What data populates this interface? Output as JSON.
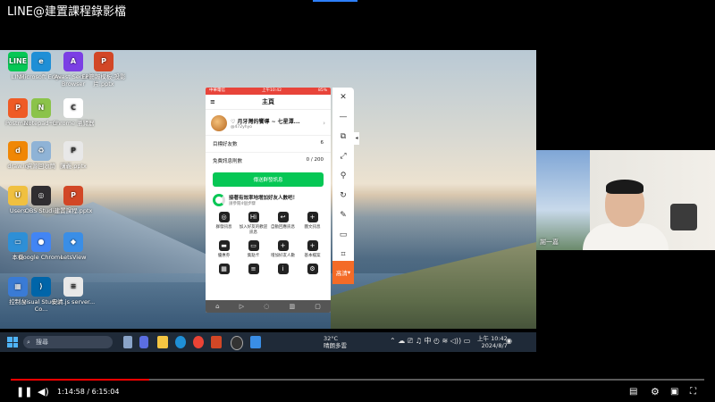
{
  "video_title": "LINE@建置課程錄影檔",
  "desktop_icons": [
    {
      "label": "LINE",
      "glyph": "LINE",
      "color": "#06c755"
    },
    {
      "label": "Microsoft Edge",
      "glyph": "e",
      "color": "#1f8fd6"
    },
    {
      "label": "Avast Secure Browser",
      "glyph": "A",
      "color": "#7b3fe4"
    },
    {
      "label": "EP簡報模板-投影片.pptx",
      "glyph": "P",
      "color": "#d24726"
    },
    {
      "label": "Postman",
      "glyph": "P",
      "color": "#ef5b25"
    },
    {
      "label": "Notepad++",
      "glyph": "N",
      "color": "#8bc34a"
    },
    {
      "label": "Chrome 瀏覽器",
      "glyph": "C",
      "color": "#ffffff"
    },
    {
      "label": "draw.io",
      "glyph": "d",
      "color": "#f08705"
    },
    {
      "label": "資源回收筒",
      "glyph": "♻",
      "color": "#8fb3d6"
    },
    {
      "label": "講義.pptx",
      "glyph": "P",
      "color": "#e8e8e8"
    },
    {
      "label": "Users",
      "glyph": "U",
      "color": "#f0c040"
    },
    {
      "label": "OBS Studio",
      "glyph": "◎",
      "color": "#302e31"
    },
    {
      "label": "建置課程.pptx",
      "glyph": "P",
      "color": "#d24726"
    },
    {
      "label": "本機",
      "glyph": "▭",
      "color": "#2e8fd6"
    },
    {
      "label": "Google Chrome",
      "glyph": "●",
      "color": "#4285f4"
    },
    {
      "label": "LetsView",
      "glyph": "◆",
      "color": "#3a8ee6"
    },
    {
      "label": "控制台",
      "glyph": "▦",
      "color": "#3a7bd5"
    },
    {
      "label": "Visual Studio Co...",
      "glyph": "⟩",
      "color": "#0065a9"
    },
    {
      "label": "安清.js server...",
      "glyph": "≡",
      "color": "#e8e8e8"
    }
  ],
  "taskbar": {
    "search_placeholder": "搜尋",
    "weather_temp": "32°C",
    "weather_text": "晴朗多雲",
    "ime": "中",
    "time": "上午 10:42",
    "date": "2024/8/7"
  },
  "phone": {
    "status_left": "中華電信",
    "status_time": "上午10:42",
    "status_right": "85%",
    "nav_title": "主頁",
    "account_name": "♡ 月牙灣的饗導 ~ 七星潭...",
    "account_id": "@472yhyo",
    "friends_label": "目標好友數",
    "friends_value": "6",
    "messages_label": "免費訊息則數",
    "messages_value": "0 / 200",
    "broadcast_button": "傳送群發訊息",
    "tip_title": "接著有效率地增加好友人數吧！",
    "tip_sub": "請參閱4個步驟",
    "grid": [
      {
        "glyph": "◎",
        "label": "群發訊息"
      },
      {
        "glyph": "Hi",
        "label": "加入好友的歡迎訊息"
      },
      {
        "glyph": "↩",
        "label": "自動回應訊息"
      },
      {
        "glyph": "+",
        "label": "圖文訊息"
      },
      {
        "glyph": "▬",
        "label": "優惠券"
      },
      {
        "glyph": "▭",
        "label": "集點卡"
      },
      {
        "glyph": "+",
        "label": "增加好友人數"
      },
      {
        "glyph": "+",
        "label": "基本檔案"
      },
      {
        "glyph": "▦",
        "label": ""
      },
      {
        "glyph": "≡",
        "label": ""
      },
      {
        "glyph": "i",
        "label": ""
      },
      {
        "glyph": "⚙",
        "label": ""
      }
    ]
  },
  "sidebar": {
    "hq_label": "高清"
  },
  "webcam": {
    "name": "謝一嘉"
  },
  "player": {
    "current_time": "1:14:58",
    "duration": "6:15:04",
    "progress": 0.2
  }
}
